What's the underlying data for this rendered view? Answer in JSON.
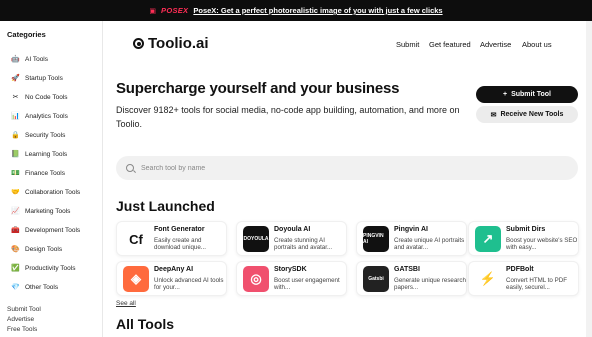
{
  "banner": {
    "icon": "camera-icon",
    "brand": "POSEX",
    "text": "PoseX: Get a perfect photorealistic image of you with just a few clicks"
  },
  "sidebar": {
    "title": "Categories",
    "items": [
      {
        "label": "AI Tools",
        "icon": "robot-icon",
        "glyph": "🤖"
      },
      {
        "label": "Startup Tools",
        "icon": "rocket-icon",
        "glyph": "🚀"
      },
      {
        "label": "No Code Tools",
        "icon": "no-code-icon",
        "glyph": "✂"
      },
      {
        "label": "Analytics Tools",
        "icon": "chart-icon",
        "glyph": "📊"
      },
      {
        "label": "Security Tools",
        "icon": "lock-icon",
        "glyph": "🔒"
      },
      {
        "label": "Learning Tools",
        "icon": "book-icon",
        "glyph": "📗"
      },
      {
        "label": "Finance Tools",
        "icon": "money-icon",
        "glyph": "💵"
      },
      {
        "label": "Collaboration Tools",
        "icon": "handshake-icon",
        "glyph": "🤝"
      },
      {
        "label": "Marketing Tools",
        "icon": "marketing-chart-icon",
        "glyph": "📈"
      },
      {
        "label": "Development Tools",
        "icon": "toolbox-icon",
        "glyph": "🧰"
      },
      {
        "label": "Design Tools",
        "icon": "palette-icon",
        "glyph": "🎨"
      },
      {
        "label": "Productivity Tools",
        "icon": "checkmark-icon",
        "glyph": "✅"
      },
      {
        "label": "Other Tools",
        "icon": "sparkle-icon",
        "glyph": "💎"
      }
    ],
    "links": [
      "Submit Tool",
      "Advertise",
      "Free Tools"
    ]
  },
  "header": {
    "logo": "Toolio.ai",
    "nav": [
      "Submit",
      "Get featured",
      "Advertise",
      "About us"
    ]
  },
  "hero": {
    "title": "Supercharge yourself and your business",
    "subtitle": "Discover 9182+ tools for social media, no-code app building, automation, and more on Toolio.",
    "submit_label": "Submit Tool",
    "receive_label": "Receive New Tools"
  },
  "search": {
    "placeholder": "Search tool by name"
  },
  "just_launched": {
    "title": "Just Launched",
    "cards": [
      {
        "name": "Font Generator",
        "desc": "Easily create and download unique...",
        "icon": "font-generator-icon",
        "bg": "#ffffff",
        "mark": "Cf",
        "markColor": "#111111"
      },
      {
        "name": "Doyoula AI",
        "desc": "Create stunning AI portraits and avatar...",
        "icon": "doyoula-logo-icon",
        "bg": "#111111",
        "mark": "DOYOULA",
        "markColor": "#ffffff"
      },
      {
        "name": "Pingvin AI",
        "desc": "Create unique AI portraits and avatar...",
        "icon": "pingvin-logo-icon",
        "bg": "#111111",
        "mark": "PINGVIN AI",
        "markColor": "#ffffff"
      },
      {
        "name": "Submit Dirs",
        "desc": "Boost your website's SEO with easy...",
        "icon": "trend-up-icon",
        "bg": "#1fbf8f",
        "mark": "↗",
        "markColor": "#ffffff"
      },
      {
        "name": "DeepAny AI",
        "desc": "Unlock advanced AI tools for your...",
        "icon": "deepany-logo-icon",
        "bg": "#ff6a3d",
        "mark": "◈",
        "markColor": "#ffffff"
      },
      {
        "name": "StorySDK",
        "desc": "Boost user engagement with...",
        "icon": "storysdk-logo-icon",
        "bg": "#f0506e",
        "mark": "◎",
        "markColor": "#ffffff"
      },
      {
        "name": "GATSBI",
        "desc": "Generate unique research papers...",
        "icon": "gatsbi-logo-icon",
        "bg": "#222222",
        "mark": "Gatsbi",
        "markColor": "#ffffff"
      },
      {
        "name": "PDFBolt",
        "desc": "Convert HTML to PDF easily, securel...",
        "icon": "lightning-bolt-icon",
        "bg": "#ffffff",
        "mark": "⚡",
        "markColor": "#2a8cff"
      }
    ],
    "see_all": "See all"
  },
  "all_tools": {
    "title": "All Tools"
  }
}
